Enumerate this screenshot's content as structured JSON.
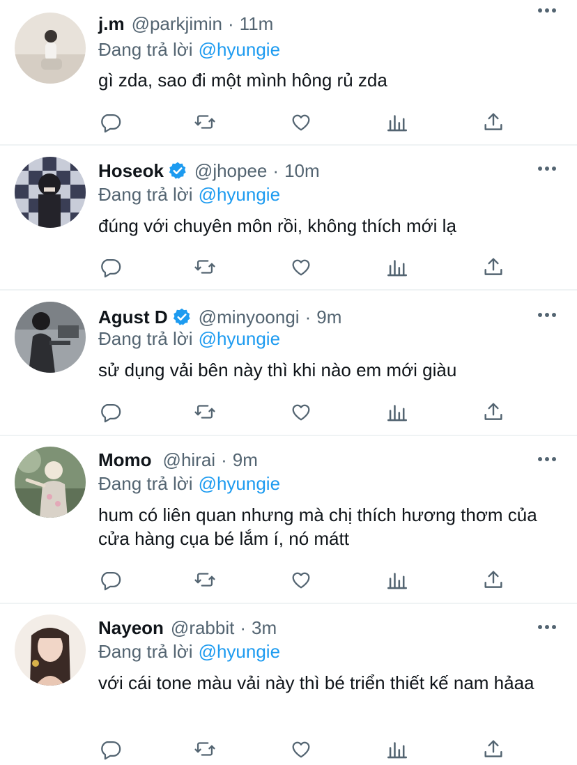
{
  "reply_prefix": "Đang trả lời",
  "replies": [
    {
      "name": "j.m",
      "handle": "@parkjimin",
      "sep": "·",
      "time": "11m",
      "verified": false,
      "mention": "@hyungie",
      "text": "gì zda, sao đi một mình hông rủ zda",
      "avatar_icon": "avatar-photo"
    },
    {
      "name": "Hoseok",
      "handle": "@jhopee",
      "sep": "·",
      "time": "10m",
      "verified": true,
      "mention": "@hyungie",
      "text": "đúng với chuyên môn rồi, không thích mới lạ",
      "avatar_icon": "avatar-photo"
    },
    {
      "name": "Agust D",
      "handle": "@minyoongi",
      "sep": "·",
      "time": "9m",
      "verified": true,
      "mention": "@hyungie",
      "text": "sử dụng vải bên này thì khi nào em mới giàu",
      "avatar_icon": "avatar-photo"
    },
    {
      "name": "Momo",
      "handle": "@hirai",
      "sep": "·",
      "time": "9m",
      "verified": false,
      "mention": "@hyungie",
      "text": "hum có liên quan nhưng mà chị thích hương thơm của cửa hàng cụa bé lắm í, nó mátt",
      "avatar_icon": "avatar-photo"
    },
    {
      "name": "Nayeon",
      "handle": "@rabbit",
      "sep": "·",
      "time": "3m",
      "verified": false,
      "mention": "@hyungie",
      "text": "với cái tone màu vải này thì bé triển thiết kế nam hảaa",
      "avatar_icon": "avatar-photo"
    }
  ],
  "colors": {
    "link": "#1d9bf0",
    "secondary": "#536471",
    "primary": "#0f1419",
    "divider": "#eff3f4"
  },
  "action_icons": [
    "reply-icon",
    "retweet-icon",
    "like-icon",
    "views-icon",
    "share-icon"
  ]
}
